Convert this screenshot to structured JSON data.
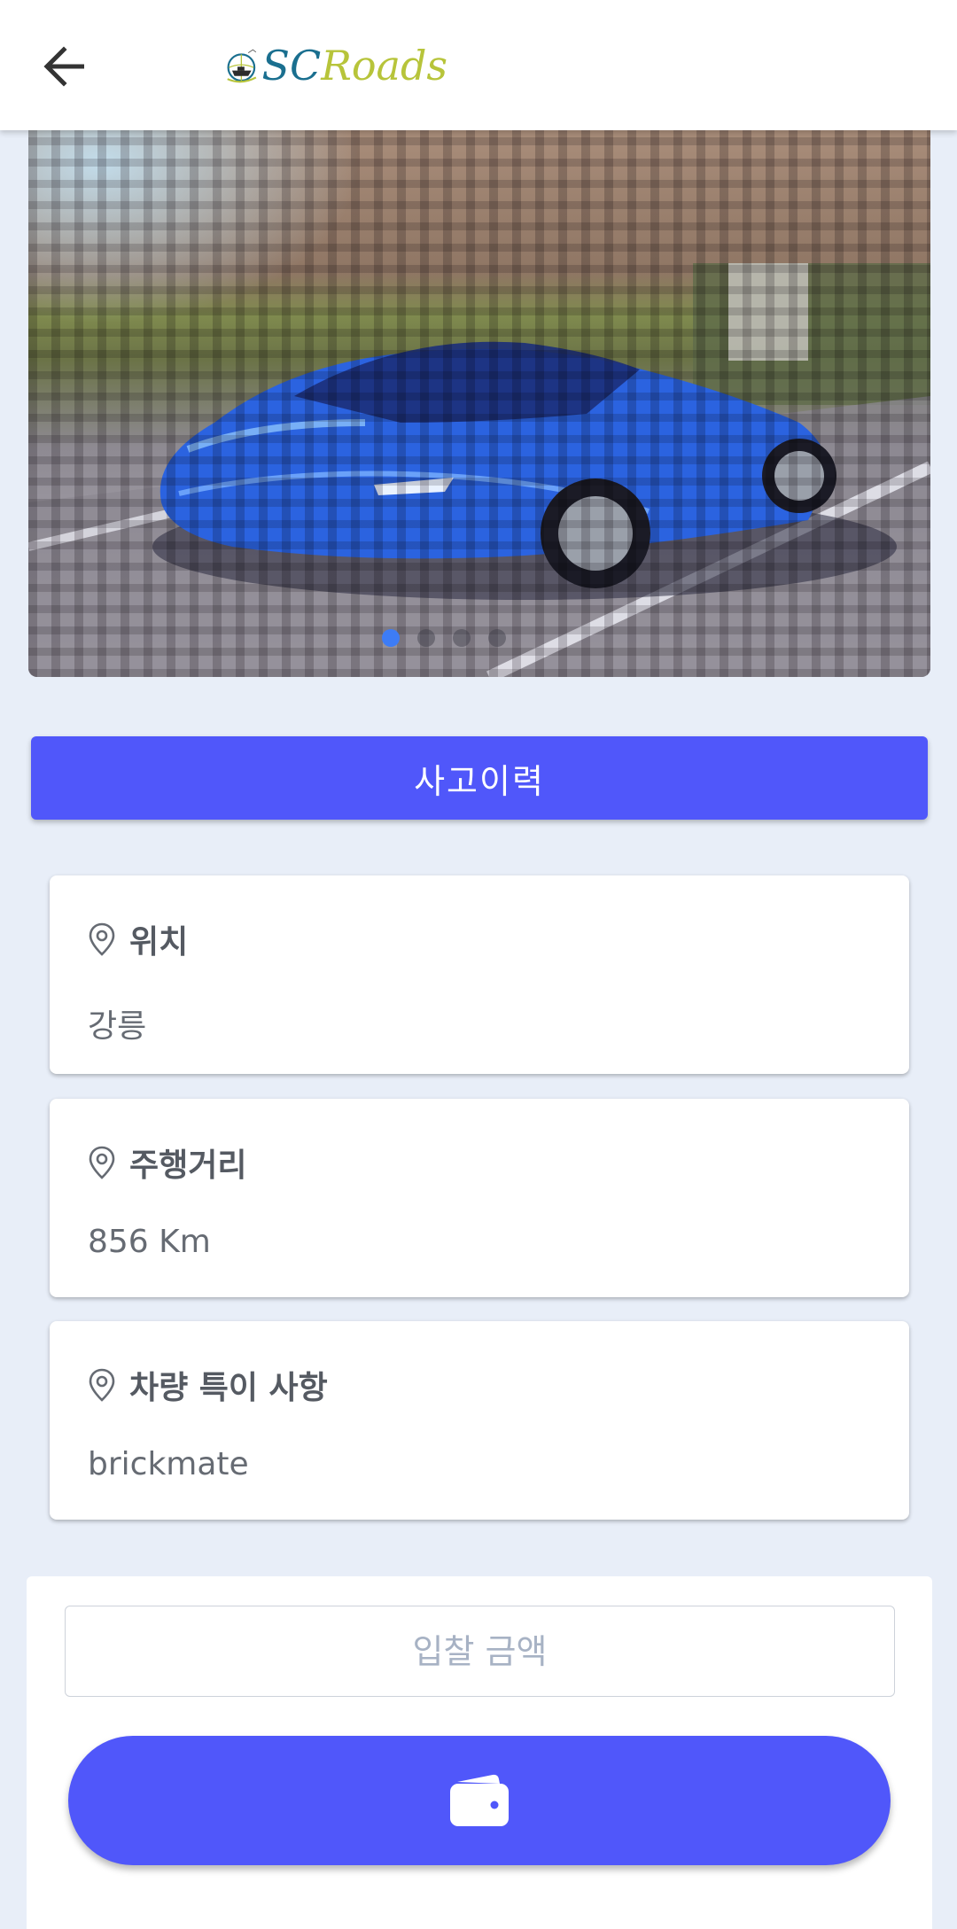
{
  "header": {
    "back_icon": "arrow-left-icon",
    "logo": {
      "text_sc": "SC",
      "text_roads": "Roads",
      "icon": "globe-ship-logo"
    }
  },
  "gallery": {
    "slide_count": 4,
    "active_index": 0,
    "accent_color": "#3d7cf5"
  },
  "history_button": {
    "label": "사고이력"
  },
  "cards": [
    {
      "icon": "location-pin-icon",
      "title": "위치",
      "value": "강릉"
    },
    {
      "icon": "location-pin-icon",
      "title": "주행거리",
      "value": "856 Km"
    },
    {
      "icon": "location-pin-icon",
      "title": "차량 특이 사항",
      "value": "brickmate"
    }
  ],
  "bid": {
    "placeholder": "입찰 금액",
    "submit_icon": "wallet-icon"
  },
  "colors": {
    "primary": "#5057fa",
    "background": "#e8eef8",
    "card": "#ffffff"
  }
}
